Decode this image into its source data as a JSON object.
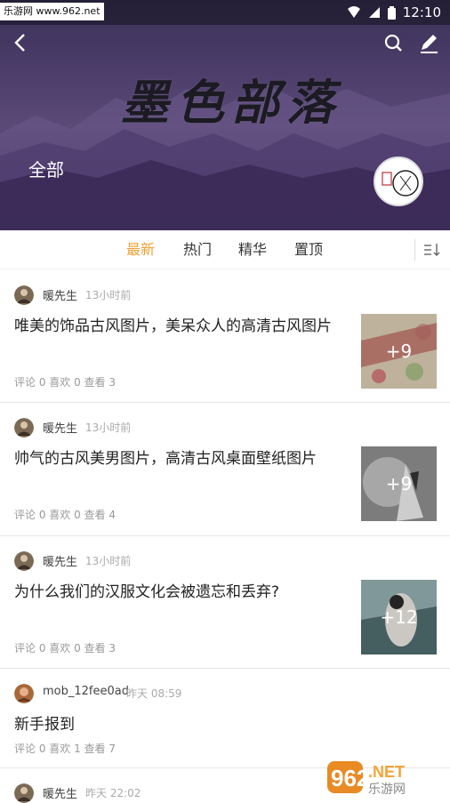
{
  "status_bar": {
    "watermark": "乐游网 www.962.net",
    "time": "12:10"
  },
  "header": {
    "title": "墨色部落",
    "category": "全部"
  },
  "tabs": [
    {
      "label": "最新",
      "active": true
    },
    {
      "label": "热门",
      "active": false
    },
    {
      "label": "精华",
      "active": false
    },
    {
      "label": "置顶",
      "active": false
    }
  ],
  "posts": [
    {
      "author": "暖先生",
      "time": "13小时前",
      "title": "唯美的饰品古风图片，美呆众人的高清古风图片",
      "stats": "评论 0  喜欢 0  查看 3",
      "image_count": "+9"
    },
    {
      "author": "暖先生",
      "time": "13小时前",
      "title": "帅气的古风美男图片，高清古风桌面壁纸图片",
      "stats": "评论 0  喜欢 0  查看 4",
      "image_count": "+9"
    },
    {
      "author": "暖先生",
      "time": "13小时前",
      "title": "为什么我们的汉服文化会被遗忘和丢弃?",
      "stats": "评论 0  喜欢 0  查看 3",
      "image_count": "+12"
    },
    {
      "author": "mob_12fee0ad",
      "time": "昨天 08:59",
      "title": "新手报到",
      "stats": "评论 0  喜欢 1  查看 7"
    },
    {
      "author": "暖先生",
      "time": "昨天 22:02"
    }
  ],
  "bottom_watermark": {
    "logo": "962",
    "suffix": ".NET",
    "site": "乐游网"
  },
  "colors": {
    "accent": "#f0a032",
    "banner": "#4b3d6a"
  }
}
